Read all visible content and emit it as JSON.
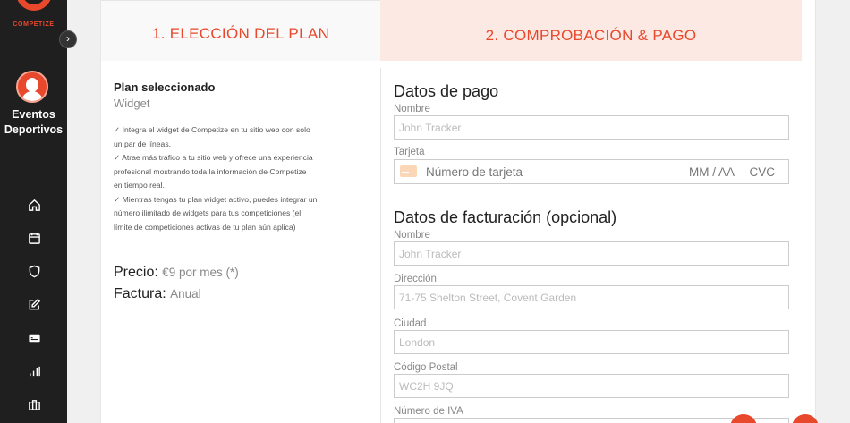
{
  "brand": {
    "logo_text": "COMPETIZE",
    "accent_color": "#e8482b"
  },
  "sidebar": {
    "toggle_icon": "chevron-right-icon",
    "org_name_line1": "Eventos",
    "org_name_line2": "Deportivos",
    "nav_icons": [
      "home-icon",
      "calendar-icon",
      "shield-icon",
      "edit-icon",
      "ticket-icon",
      "stats-icon",
      "briefcase-icon"
    ]
  },
  "steps": {
    "step1": "1. ELECCIÓN DEL PLAN",
    "step2": "2. COMPROBACIÓN & PAGO"
  },
  "plan": {
    "title": "Plan seleccionado",
    "name": "Widget",
    "features": [
      "✓ Integra el widget de Competize en tu sitio web con solo",
      "un par de líneas.",
      "✓ Atrae más tráfico a tu sitio web y ofrece una experiencia",
      "profesional mostrando toda la información de Competize",
      "en tiempo real.",
      "✓ Mientras tengas tu plan widget activo, puedes integrar un",
      "número ilimitado de widgets para tus competiciones (el",
      "límite de competiciones activas de tu plan aún aplica)"
    ],
    "price_label": "Precio:",
    "price_value": "€9 por mes (*)",
    "billing_label": "Factura:",
    "billing_value": "Anual"
  },
  "payment": {
    "title": "Datos de pago",
    "name_label": "Nombre",
    "name_placeholder": "John Tracker",
    "card_label": "Tarjeta",
    "card_number_placeholder": "Número de tarjeta",
    "card_expiry_placeholder": "MM / AA",
    "card_cvc_placeholder": "CVC"
  },
  "billing_data": {
    "title": "Datos de facturación (opcional)",
    "name_label": "Nombre",
    "name_placeholder": "John Tracker",
    "address_label": "Dirección",
    "address_placeholder": "71-75 Shelton Street, Covent Garden",
    "city_label": "Ciudad",
    "city_placeholder": "London",
    "postal_label": "Código Postal",
    "postal_placeholder": "WC2H 9JQ",
    "vat_label": "Número de IVA"
  }
}
